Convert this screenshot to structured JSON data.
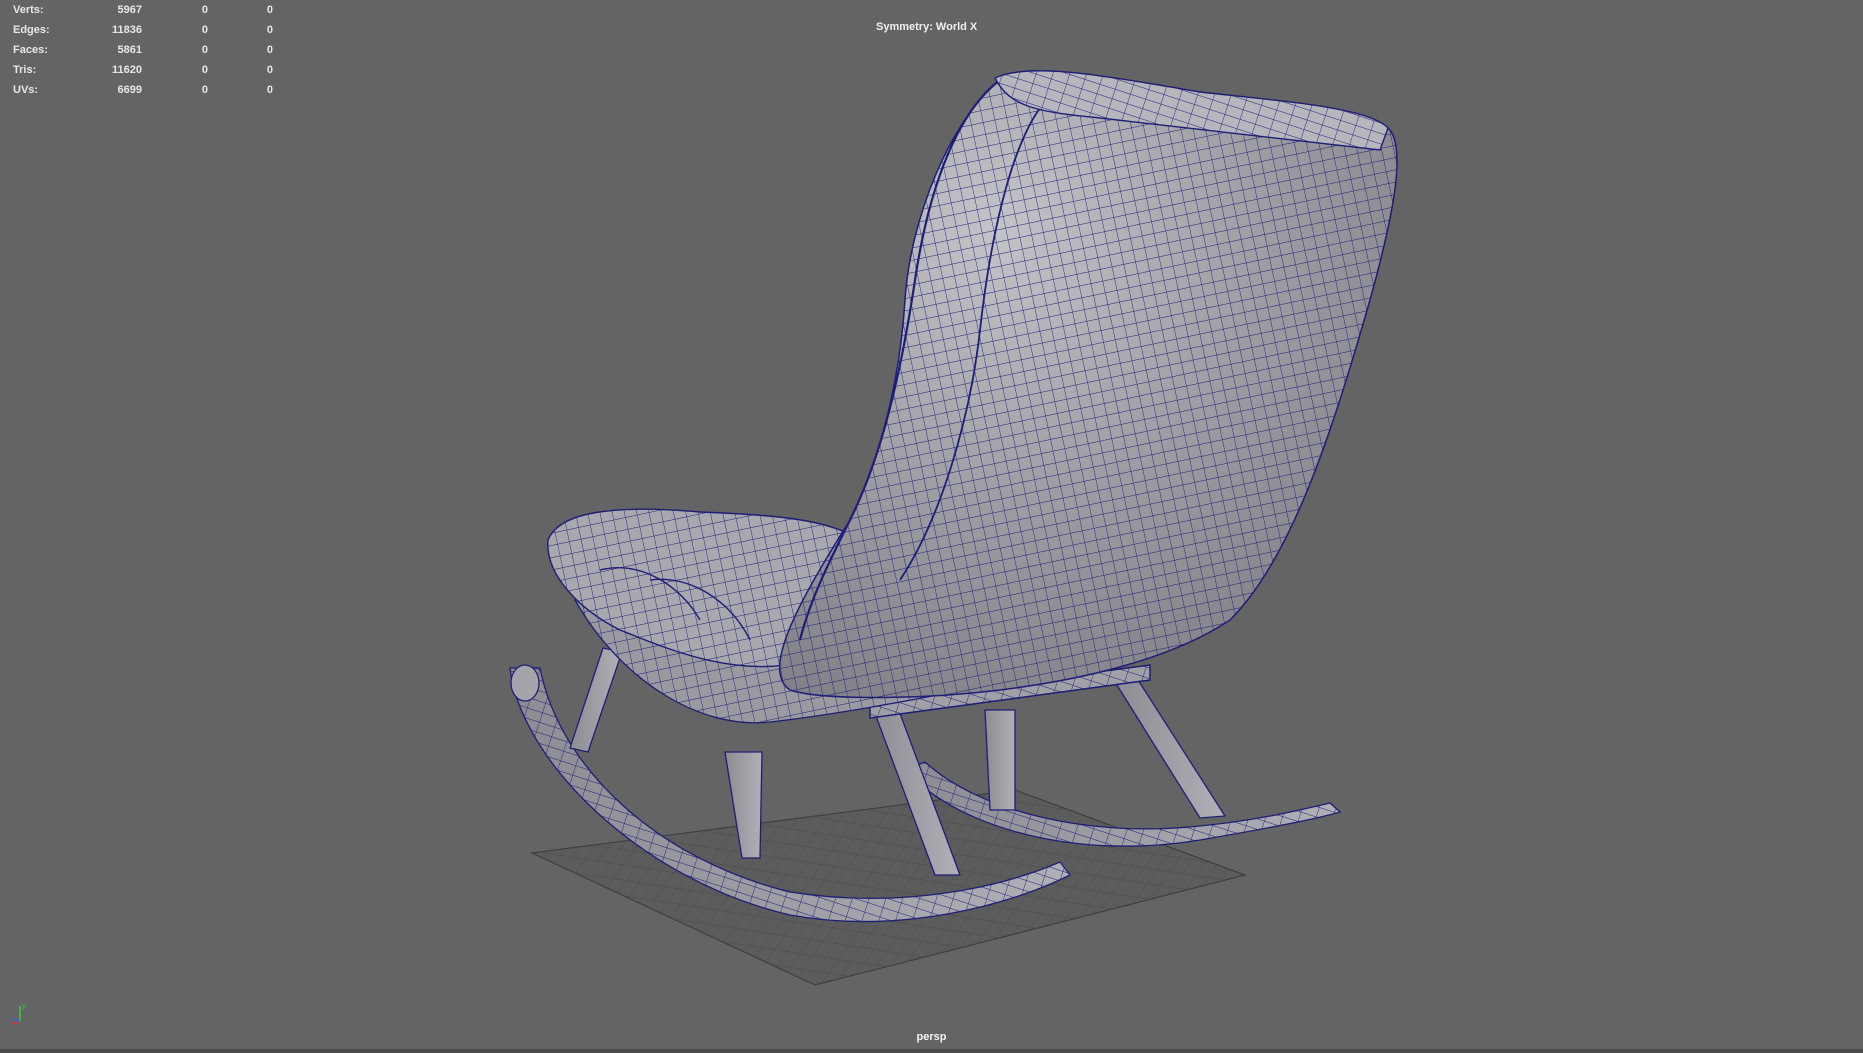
{
  "viewport": {
    "background": "#646464",
    "wire_color": "#1e1e78",
    "mesh_color": "#9a9aa0"
  },
  "hud": {
    "rows": [
      {
        "label": "Verts:",
        "v1": "5967",
        "v2": "0",
        "v3": "0"
      },
      {
        "label": "Edges:",
        "v1": "11836",
        "v2": "0",
        "v3": "0"
      },
      {
        "label": "Faces:",
        "v1": "5861",
        "v2": "0",
        "v3": "0"
      },
      {
        "label": "Tris:",
        "v1": "11620",
        "v2": "0",
        "v3": "0"
      },
      {
        "label": "UVs:",
        "v1": "6699",
        "v2": "0",
        "v3": "0"
      }
    ]
  },
  "symmetry_label": "Symmetry: World X",
  "camera_label": "persp",
  "axis_gizmo": {
    "label": "y",
    "icon": "axis-gizmo-icon"
  }
}
